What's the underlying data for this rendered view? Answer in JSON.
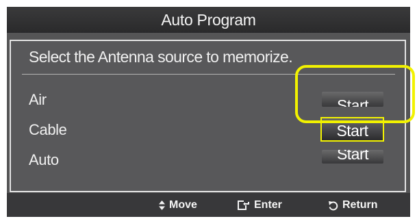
{
  "window": {
    "title": "Auto Program"
  },
  "content": {
    "instruction": "Select the Antenna source to memorize.",
    "rows": [
      {
        "label": "Air",
        "button_label": "Start"
      },
      {
        "label": "Cable",
        "button_label": "Start"
      },
      {
        "label": "Auto",
        "button_label": "Start"
      }
    ],
    "focused_row": "Cable"
  },
  "footer": {
    "move_label": "Move",
    "enter_label": "Enter",
    "return_label": "Return",
    "move_icon": "up-down-arrows-icon",
    "enter_icon": "enter-icon",
    "return_icon": "return-icon"
  },
  "colors": {
    "highlight": "#f2f200",
    "panel": "#555556",
    "title_bar": "#2f2f30",
    "footer": "#38383a"
  }
}
